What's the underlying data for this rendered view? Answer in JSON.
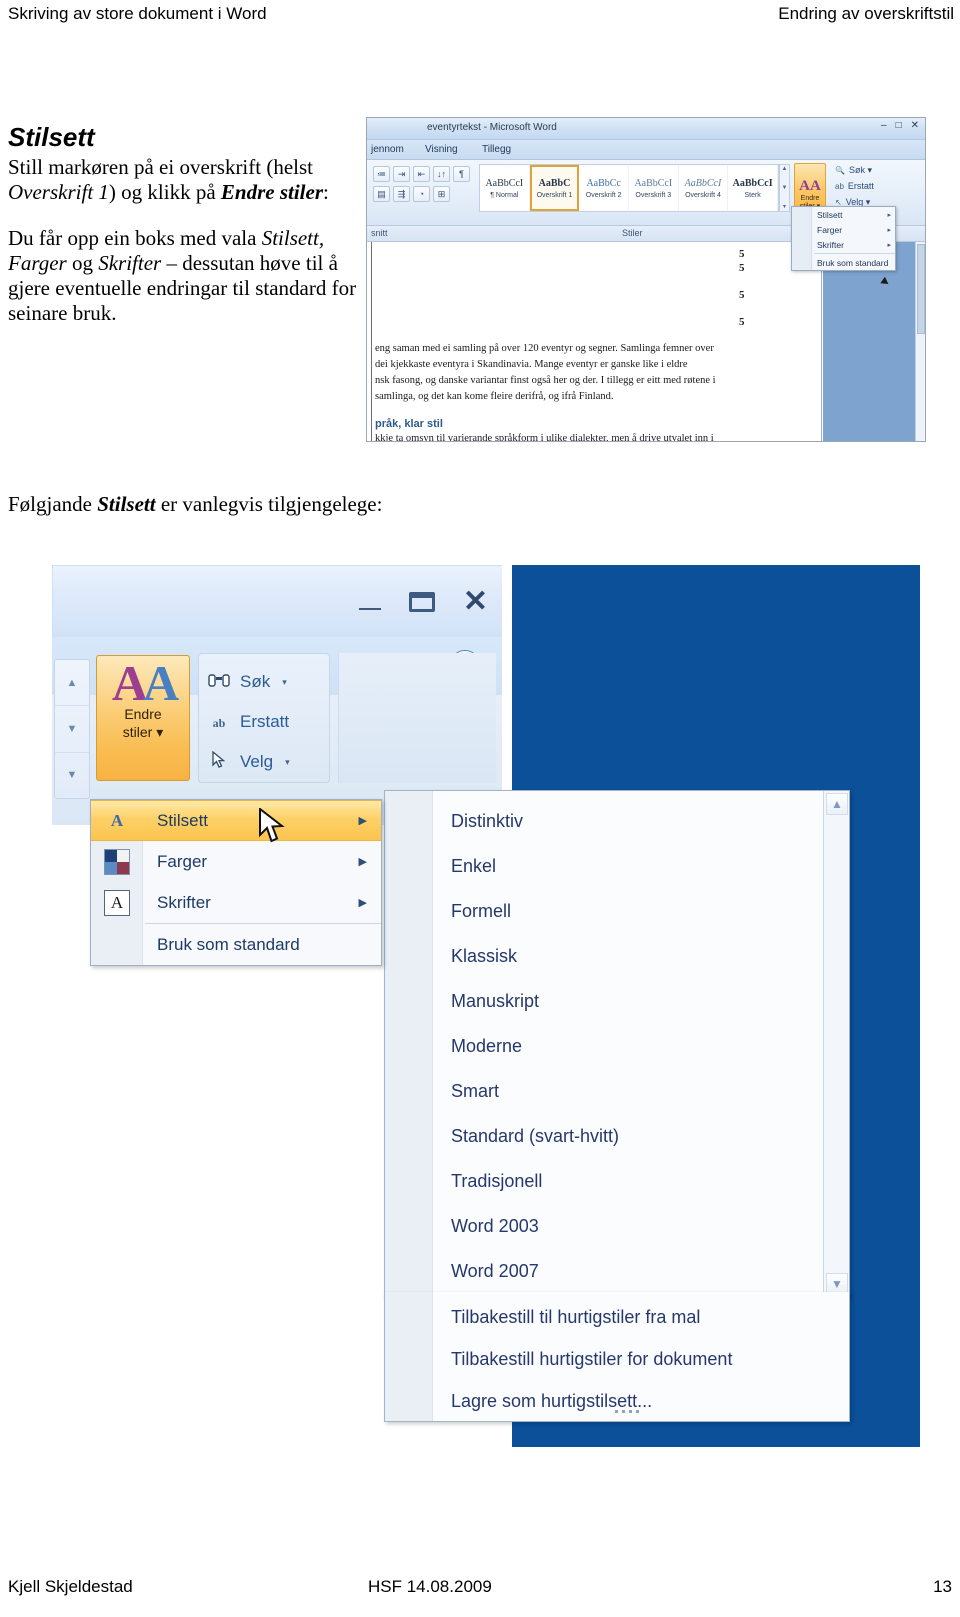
{
  "page_header": {
    "left": "Skriving av store dokument i Word",
    "right": "Endring av overskriftstil"
  },
  "lead": {
    "title": "Stilsett",
    "p1_a": "Still markøren på ei overskrift (helst ",
    "p1_em": "Overskrift 1",
    "p1_b": ") og klikk på ",
    "p1_strong": "Endre stiler",
    "p1_c": ":",
    "p2_a": "Du får opp ein boks med vala ",
    "p2_em1": "Stilsett, Farger",
    "p2_b": " og ",
    "p2_em2": "Skrifter",
    "p2_c": " – dessutan høve til å gjere eventuelle endringar til standard for seinare bruk."
  },
  "caption": {
    "a": "Følgjande ",
    "strong": "Stilsett",
    "b": " er vanlegvis tilgjengelege:"
  },
  "screenshot_small": {
    "title": "eventyrtekst - Microsoft Word",
    "window_buttons": [
      "–",
      "□",
      "✕"
    ],
    "tabs": [
      "jennom",
      "Visning",
      "Tillegg"
    ],
    "left_icons_row1": [
      "≔",
      "⇥",
      "⇤",
      "↓↑",
      "¶"
    ],
    "left_icons_row2": [
      "▤",
      "⇶",
      "◔",
      "⊞"
    ],
    "gallery": [
      {
        "sample": "AaBbCcI",
        "label": "¶ Normal"
      },
      {
        "sample": "AaBbC",
        "label": "Overskrift 1"
      },
      {
        "sample": "AaBbCc",
        "label": "Overskrift 2"
      },
      {
        "sample": "AaBbCcI",
        "label": "Overskrift 3"
      },
      {
        "sample": "AaBbCcI",
        "label": "Overskrift 4"
      },
      {
        "sample": "AaBbCcI",
        "label": "Sterk"
      }
    ],
    "endre_button": {
      "icon": "AA",
      "line1": "Endre",
      "line2": "stiler ▾"
    },
    "edit_items": [
      {
        "icon": "🔍",
        "label": "Søk ▾"
      },
      {
        "icon": "ab",
        "label": "Erstatt"
      },
      {
        "icon": "↖",
        "label": "Velg ▾"
      }
    ],
    "group_labels": {
      "left": "snitt",
      "styles": "Stiler"
    },
    "menu_items": [
      {
        "icon": "A",
        "label": "Stilsett",
        "arrow": "▸"
      },
      {
        "icon": "▨",
        "label": "Farger",
        "arrow": "▸"
      },
      {
        "icon": "A",
        "label": "Skrifter",
        "arrow": "▸"
      },
      {
        "icon": "",
        "label": "Bruk som standard",
        "arrow": ""
      }
    ],
    "doc_numbers": [
      "5",
      "5",
      "5",
      "5"
    ],
    "doc_lines": [
      "eng saman med ei samling på over 120 eventyr og segner.  Samlinga femner over",
      "dei kjekkaste eventyra i Skandinavia.  Mange eventyr er ganske like i eldre",
      "nsk fasong, og danske variantar finst også her og der.  I tillegg er eitt med røtene i",
      "samlinga,  og det kan kome fleire derifrå, og ifrå Finland."
    ],
    "doc_heading": "pråk, klar stil",
    "doc_tail": "kkje ta omsyn til varierande språkform i ulike dialekter, men å drive utvalet inn i"
  },
  "screenshot_large": {
    "window_buttons": {
      "minimize": "minimize-icon",
      "maximize": "maximize-icon",
      "close": "✕"
    },
    "help_button": "?",
    "scroll_buttons": [
      "▲",
      "▼",
      "▼"
    ],
    "endre_button": {
      "letter_a1": "A",
      "letter_a2": "A",
      "line1": "Endre",
      "line2": "stiler ▾"
    },
    "edit_items": [
      {
        "icon": "🔍",
        "label": "Søk",
        "arrow": "▾"
      },
      {
        "icon": "ab",
        "label": "Erstatt",
        "arrow": ""
      },
      {
        "icon": "↖",
        "label": "Velg",
        "arrow": "▾"
      }
    ],
    "menu_items": [
      {
        "icon": "styleset-icon",
        "label": "Stilsett",
        "arrow": "▶",
        "highlighted": true
      },
      {
        "icon": "colors-icon",
        "label": "Farger",
        "arrow": "▶",
        "highlighted": false
      },
      {
        "icon": "fonts-icon",
        "label": "Skrifter",
        "arrow": "▶",
        "highlighted": false
      },
      {
        "icon": "",
        "label": "Bruk som standard",
        "arrow": "",
        "highlighted": false
      }
    ],
    "style_sets": [
      "Distinktiv",
      "Enkel",
      "Formell",
      "Klassisk",
      "Manuskript",
      "Moderne",
      "Smart",
      "Standard (svart-hvitt)",
      "Tradisjonell",
      "Word 2003",
      "Word 2007"
    ],
    "style_actions": [
      "Tilbakestill til hurtigstiler fra mal",
      "Tilbakestill hurtigstiler for dokument",
      "Lagre som hurtigstilsett..."
    ],
    "submenu_scroll": {
      "up": "▲",
      "down": "▼"
    }
  },
  "page_footer": {
    "left": "Kjell Skjeldestad",
    "center": "HSF 14.08.2009",
    "right": "13"
  },
  "colors": {
    "navy_backdrop": "#0b5099",
    "highlight_gold": "#fcc44e",
    "menu_text": "#26386b",
    "ribbon_blue": "#dbe7f5"
  }
}
